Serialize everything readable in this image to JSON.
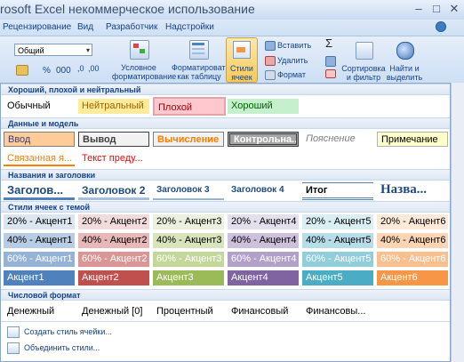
{
  "window": {
    "title": "rosoft Excel некоммерческое использование",
    "controls": [
      "–",
      "□",
      "✕"
    ]
  },
  "tabs": [
    "Рецензирование",
    "Вид",
    "Разработчик",
    "Надстройки"
  ],
  "ribbon": {
    "number_format": "Общий",
    "percent": "%",
    "thousands": "000",
    "buttons": {
      "conditional": [
        "Условное",
        "форматирование"
      ],
      "format_table": [
        "Форматировать",
        "как таблицу"
      ],
      "cell_styles": [
        "Стили",
        "ячеек"
      ],
      "insert": "Вставить",
      "delete": "Удалить",
      "format": "Формат",
      "sort": [
        "Сортировка",
        "и фильтр"
      ],
      "find": [
        "Найти и",
        "выделить"
      ],
      "sum": "Σ"
    }
  },
  "gallery": {
    "sections": {
      "good_bad": "Хороший, плохой и нейтральный",
      "data_model": "Данные и модель",
      "titles": "Названия и заголовки",
      "themed": "Стили ячеек с темой",
      "number": "Числовой формат"
    },
    "good_bad": [
      "Обычный",
      "Нейтральный",
      "Плохой",
      "Хороший"
    ],
    "data_model_row1": [
      "Ввод",
      "Вывод",
      "Вычисление",
      "Контрольна...",
      "Пояснение",
      "Примечание"
    ],
    "data_model_row2": [
      "Связанная я...",
      "Текст преду..."
    ],
    "titles": [
      "Заголов...",
      "Заголовок 2",
      "Заголовок 3",
      "Заголовок 4",
      "Итог",
      "Назва..."
    ],
    "themed_20": [
      "20% - Акцент1",
      "20% - Акцент2",
      "20% - Акцент3",
      "20% - Акцент4",
      "20% - Акцент5",
      "20% - Акцент6"
    ],
    "themed_40": [
      "40% - Акцент1",
      "40% - Акцент2",
      "40% - Акцент3",
      "40% - Акцент4",
      "40% - Акцент5",
      "40% - Акцент6"
    ],
    "themed_60": [
      "60% - Акцент1",
      "60% - Акцент2",
      "60% - Акцент3",
      "60% - Акцент4",
      "60% - Акцент5",
      "60% - Акцент6"
    ],
    "themed_100": [
      "Акцент1",
      "Акцент2",
      "Акцент3",
      "Акцент4",
      "Акцент5",
      "Акцент6"
    ],
    "number_formats": [
      "Денежный",
      "Денежный [0]",
      "Процентный",
      "Финансовый",
      "Финансовы..."
    ]
  },
  "menu": {
    "create_style": "Создать стиль ячейки...",
    "merge_styles": "Объединить стили..."
  },
  "colors": {
    "accent1": "#4f81bd",
    "accent2": "#c0504d",
    "accent3": "#9bbb59",
    "accent4": "#8064a2",
    "accent5": "#4bacc6",
    "accent6": "#f79646"
  }
}
